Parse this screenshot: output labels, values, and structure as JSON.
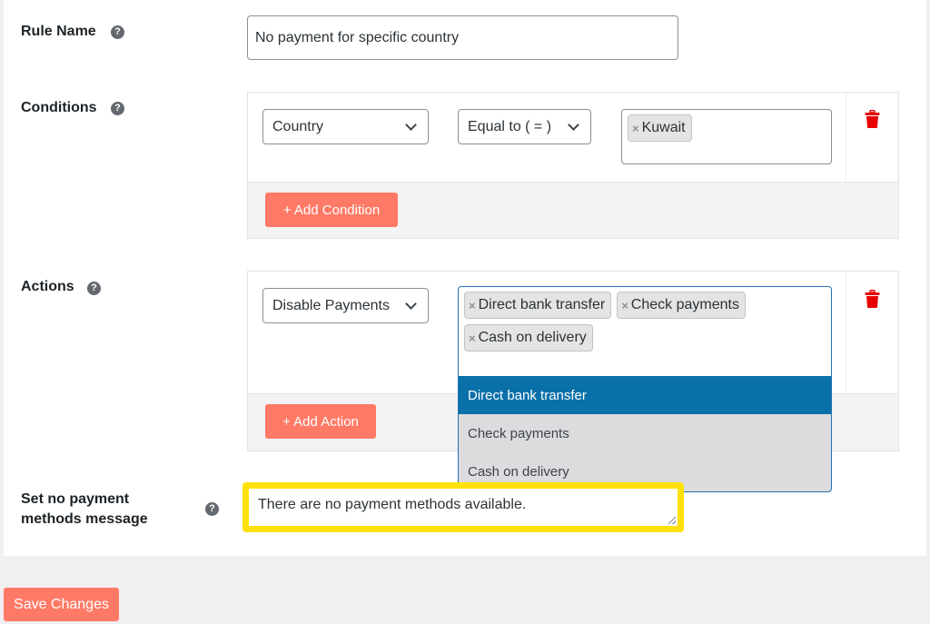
{
  "form": {
    "rule_name": {
      "label": "Rule Name",
      "help_icon": "?",
      "value": "No payment for specific country"
    },
    "conditions": {
      "label": "Conditions",
      "help_icon": "?",
      "rows": [
        {
          "field": "Country",
          "operator": "Equal to ( = )",
          "values": [
            "Kuwait"
          ]
        }
      ],
      "add_button": "+ Add Condition"
    },
    "actions": {
      "label": "Actions",
      "help_icon": "?",
      "rows": [
        {
          "action": "Disable Payments",
          "values": [
            "Direct bank transfer",
            "Check payments",
            "Cash on delivery"
          ]
        }
      ],
      "add_button": "+ Add Action",
      "dropdown": {
        "open": true,
        "options": [
          "Direct bank transfer",
          "Check payments",
          "Cash on delivery"
        ],
        "highlighted": "Direct bank transfer"
      }
    },
    "message": {
      "label": "Set no payment methods message",
      "help_icon": "?",
      "value": "There are no payment methods available."
    }
  },
  "chip_remove_glyph": "×",
  "save_button": "Save Changes",
  "colors": {
    "accent_button": "#ff7a66",
    "delete_icon": "#e60000",
    "dropdown_highlight": "#0a70a9",
    "focus_highlight": "#ffe10a"
  }
}
